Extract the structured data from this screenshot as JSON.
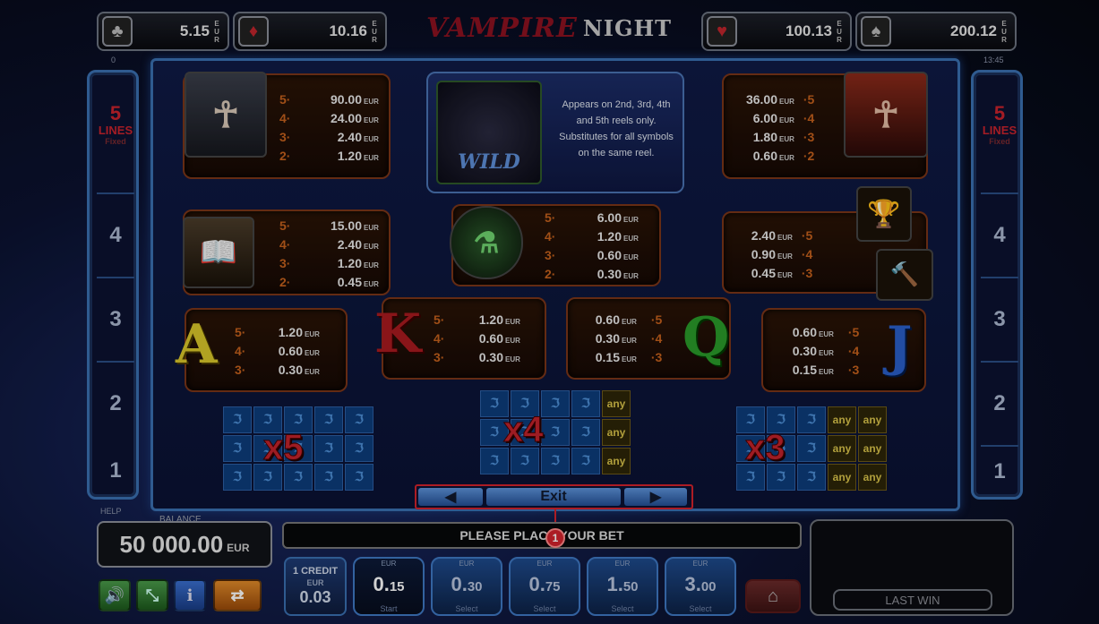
{
  "title": {
    "part1": "VAMPIRE",
    "part2": "NIGHT"
  },
  "jackpots": [
    {
      "suit": "♣",
      "suit_name": "clubs",
      "value": "5.15",
      "currency": "EUR"
    },
    {
      "suit": "♦",
      "suit_name": "diamonds",
      "value": "10.16",
      "currency": "EUR"
    },
    {
      "suit": "♥",
      "suit_name": "hearts",
      "value": "100.13",
      "currency": "EUR"
    },
    {
      "suit": "♠",
      "suit_name": "spades",
      "value": "200.12",
      "currency": "EUR"
    }
  ],
  "zero_label": "0",
  "clock": "13:45",
  "lines_panel": {
    "count": "5",
    "label": "LINES",
    "sub": "Fixed",
    "numbers": [
      "4",
      "3",
      "2",
      "1"
    ]
  },
  "wild": {
    "label": "WILD",
    "text": "Appears on 2nd, 3rd, 4th and 5th reels only. Substitutes for all symbols on the same reel."
  },
  "paytable": {
    "vampire_male": [
      {
        "n": "5·",
        "v": "90.00"
      },
      {
        "n": "4·",
        "v": "24.00"
      },
      {
        "n": "3·",
        "v": "2.40"
      },
      {
        "n": "2·",
        "v": "1.20"
      }
    ],
    "vampire_female": [
      {
        "n": "·5",
        "v": "36.00"
      },
      {
        "n": "·4",
        "v": "6.00"
      },
      {
        "n": "·3",
        "v": "1.80"
      },
      {
        "n": "·2",
        "v": "0.60"
      }
    ],
    "book": [
      {
        "n": "5·",
        "v": "15.00"
      },
      {
        "n": "4·",
        "v": "2.40"
      },
      {
        "n": "3·",
        "v": "1.20"
      },
      {
        "n": "2·",
        "v": "0.45"
      }
    ],
    "potion": [
      {
        "n": "5·",
        "v": "6.00"
      },
      {
        "n": "4·",
        "v": "1.20"
      },
      {
        "n": "3·",
        "v": "0.60"
      },
      {
        "n": "2·",
        "v": "0.30"
      }
    ],
    "chalice_stake": [
      {
        "n": "·5",
        "v": "2.40"
      },
      {
        "n": "·4",
        "v": "0.90"
      },
      {
        "n": "·3",
        "v": "0.45"
      }
    ],
    "ace": [
      {
        "n": "5·",
        "v": "1.20"
      },
      {
        "n": "4·",
        "v": "0.60"
      },
      {
        "n": "3·",
        "v": "0.30"
      }
    ],
    "king": [
      {
        "n": "5·",
        "v": "1.20"
      },
      {
        "n": "4·",
        "v": "0.60"
      },
      {
        "n": "3·",
        "v": "0.30"
      }
    ],
    "queen": [
      {
        "n": "·5",
        "v": "0.60"
      },
      {
        "n": "·4",
        "v": "0.30"
      },
      {
        "n": "·3",
        "v": "0.15"
      }
    ],
    "jack": [
      {
        "n": "·5",
        "v": "0.60"
      },
      {
        "n": "·4",
        "v": "0.30"
      },
      {
        "n": "·3",
        "v": "0.15"
      }
    ],
    "eur": "EUR",
    "letters": {
      "a": "A",
      "k": "K",
      "q": "Q",
      "j": "J"
    }
  },
  "wild_grids": {
    "x5": "x5",
    "x4": "x4",
    "x3": "x3",
    "any": "any"
  },
  "nav": {
    "prev": "◀",
    "exit": "Exit",
    "next": "▶"
  },
  "marker": "1",
  "help": "HELP",
  "balance": {
    "label": "BALANCE",
    "value": "50 000.00",
    "currency": "EUR"
  },
  "message": "PLEASE PLACE YOUR BET",
  "credit": {
    "label": "1 CREDIT",
    "currency": "EUR",
    "value": "0.03"
  },
  "bets": [
    {
      "int": "0.",
      "dec": "15",
      "currency": "EUR",
      "action": "Start",
      "selected": true
    },
    {
      "int": "0.",
      "dec": "30",
      "currency": "EUR",
      "action": "Select"
    },
    {
      "int": "0.",
      "dec": "75",
      "currency": "EUR",
      "action": "Select"
    },
    {
      "int": "1.",
      "dec": "50",
      "currency": "EUR",
      "action": "Select"
    },
    {
      "int": "3.",
      "dec": "00",
      "currency": "EUR",
      "action": "Select"
    }
  ],
  "last_win": "LAST WIN",
  "colors": {
    "accent_red": "#d2232d",
    "payout_orange": "#c5611d",
    "panel_blue": "#3a6fb0"
  }
}
